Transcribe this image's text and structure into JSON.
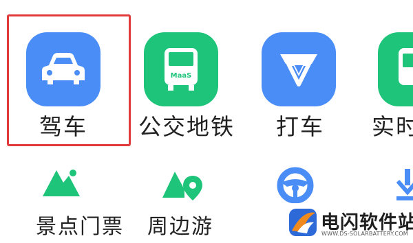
{
  "top_row": [
    {
      "name": "drive",
      "label": "驾车",
      "icon": "car-icon",
      "color": "#4a8df6"
    },
    {
      "name": "transit",
      "label": "公交地铁",
      "icon": "bus-icon",
      "color": "#1dc47a",
      "badge": "MaaS"
    },
    {
      "name": "taxi",
      "label": "打车",
      "icon": "taxi-logo-icon",
      "color": "#4a8df6"
    },
    {
      "name": "realtime",
      "label": "实时",
      "icon": "realtime-bus-icon",
      "color": "#1dc47a"
    }
  ],
  "bottom_row": [
    {
      "name": "scenic-tickets",
      "label": "景点门票",
      "icon": "mountain-icon",
      "color": "#1dc47a"
    },
    {
      "name": "nearby-tour",
      "label": "周边游",
      "icon": "mountain-pin-icon",
      "color": "#1dc47a"
    },
    {
      "name": "driving-service",
      "label": "",
      "icon": "steering-wheel-icon",
      "color": "#4a8df6"
    },
    {
      "name": "download",
      "label": "",
      "icon": "download-icon",
      "color": "#4a8df6"
    }
  ],
  "selected": "drive",
  "highlight_color": "#e03a3a",
  "watermark": {
    "title": "电闪软件站",
    "url": "WWW.DS-SOLARBATTERY.COM"
  }
}
